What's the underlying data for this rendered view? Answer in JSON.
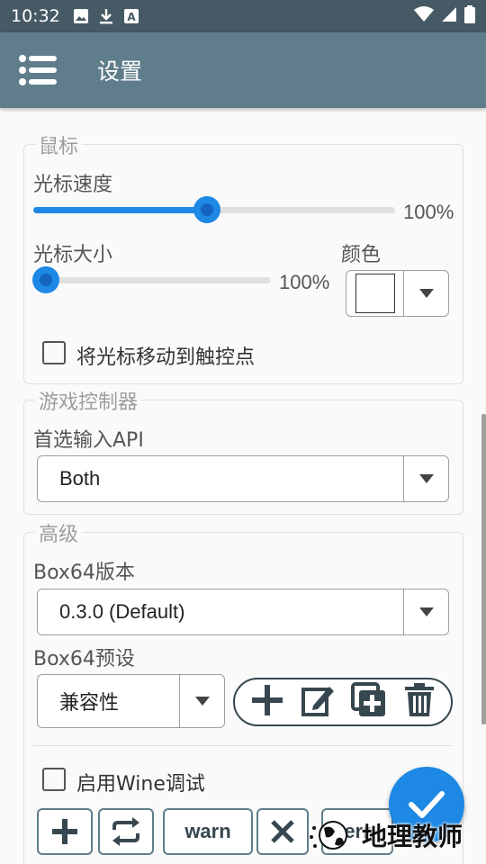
{
  "status": {
    "time": "10:32"
  },
  "appbar": {
    "title": "设置"
  },
  "mouse": {
    "section_title": "鼠标",
    "speed_label": "光标速度",
    "speed_value": "100%",
    "speed_fraction": 0.48,
    "size_label": "光标大小",
    "size_value": "100%",
    "size_fraction": 0.0,
    "color_label": "颜色",
    "color_value": "#ffffff",
    "move_to_touch_label": "将光标移动到触控点"
  },
  "gamepad": {
    "section_title": "游戏控制器",
    "api_label": "首选输入API",
    "api_value": "Both"
  },
  "advanced": {
    "section_title": "高级",
    "box64_version_label": "Box64版本",
    "box64_version_value": "0.3.0 (Default)",
    "box64_preset_label": "Box64预设",
    "box64_preset_value": "兼容性",
    "wine_debug_label": "启用Wine调试",
    "warn_label": "warn",
    "err_label": "err"
  },
  "watermark": {
    "text": "地理教师"
  }
}
